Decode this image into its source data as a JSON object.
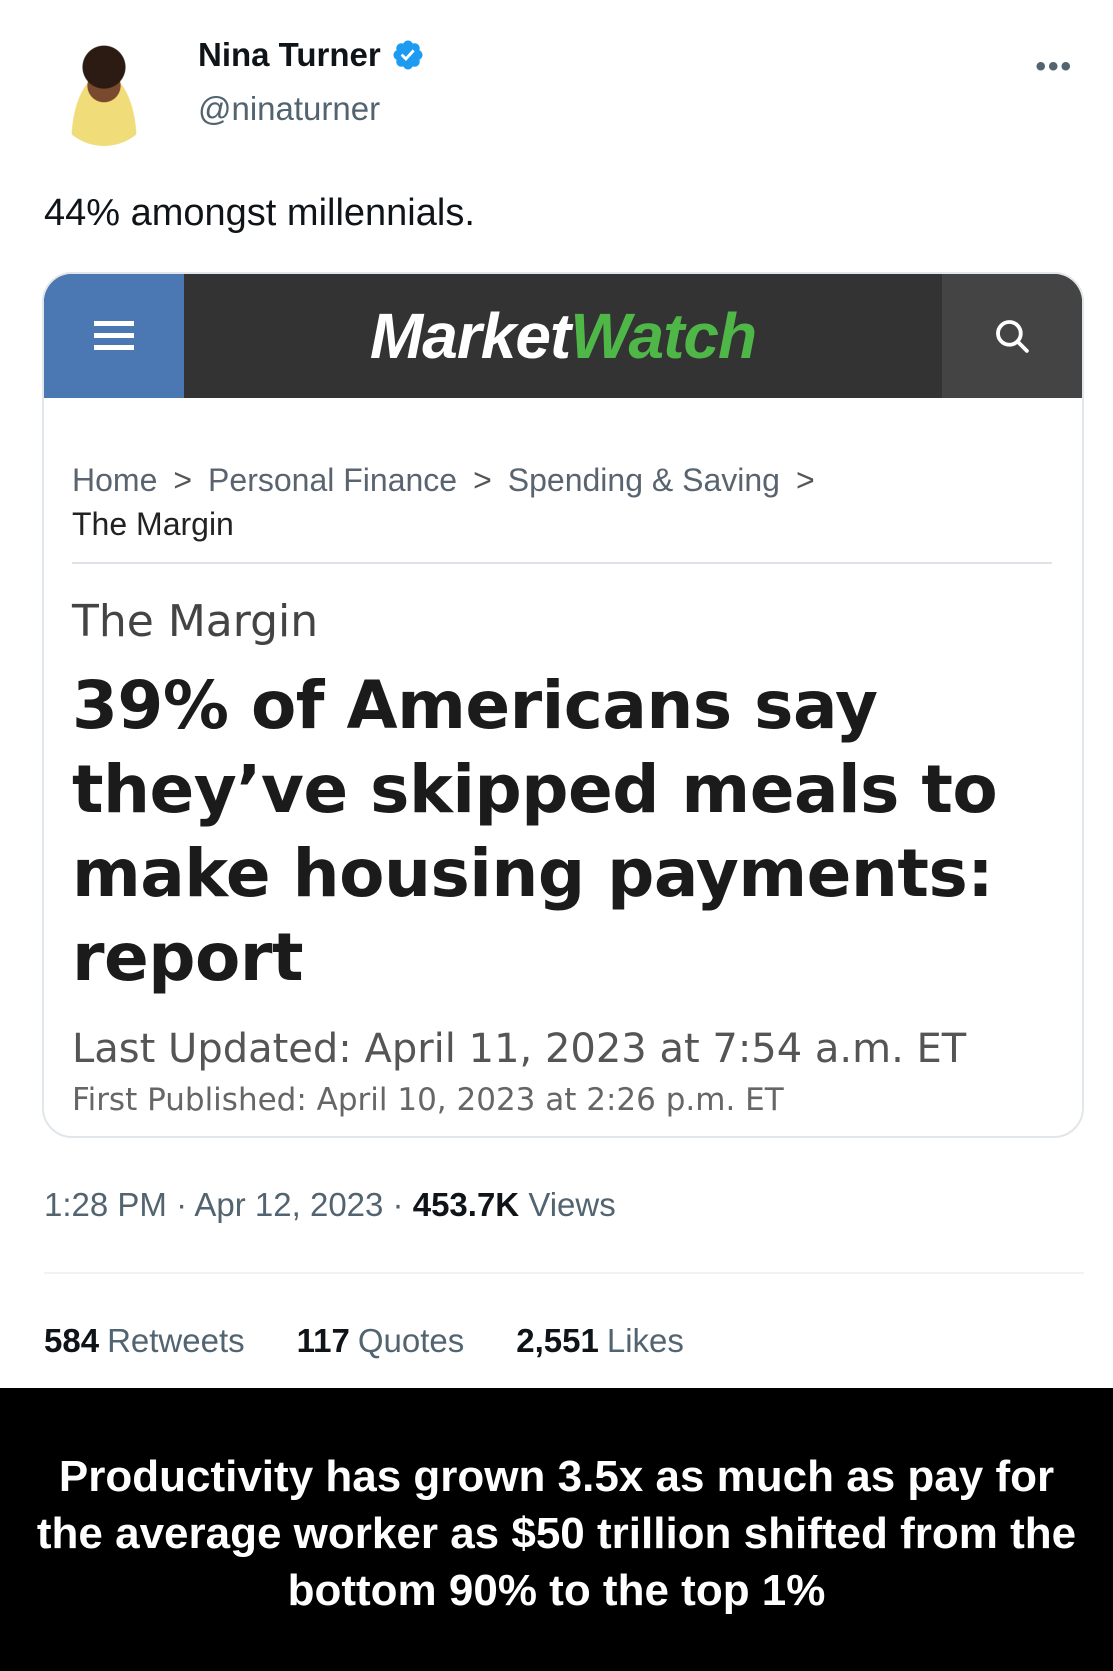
{
  "tweet": {
    "author_name": "Nina Turner",
    "author_handle": "@ninaturner",
    "verified": true,
    "text": "44% amongst millennials.",
    "meta": {
      "time": "1:28 PM · Apr 12, 2023 · ",
      "views_count": "453.7K",
      "views_label": "Views"
    },
    "stats": {
      "retweets_count": "584",
      "retweets_label": "Retweets",
      "quotes_count": "117",
      "quotes_label": "Quotes",
      "likes_count": "2,551",
      "likes_label": "Likes"
    }
  },
  "card": {
    "logo_market": "Market",
    "logo_watch": "Watch",
    "breadcrumb": {
      "home": "Home",
      "personal_finance": "Personal Finance",
      "spending_saving": "Spending & Saving",
      "current": "The Margin",
      "separator": ">"
    },
    "section": "The Margin",
    "headline": "39% of Americans say they’ve skipped meals to make housing payments: report",
    "last_updated": "Last Updated: April 11, 2023 at 7:54 a.m. ET",
    "first_published": "First Published: April 10, 2023 at 2:26 p.m. ET"
  },
  "caption": "Productivity has grown 3.5x as much as pay for the average worker as $50 trillion shifted from the bottom 90% to the top 1%",
  "colors": {
    "verified_blue": "#1d9bf0",
    "marketwatch_green": "#4fb648",
    "menu_blue": "#4b78b2"
  },
  "icons": [
    "verified-badge-icon",
    "more-options-icon",
    "hamburger-menu-icon",
    "search-icon"
  ]
}
